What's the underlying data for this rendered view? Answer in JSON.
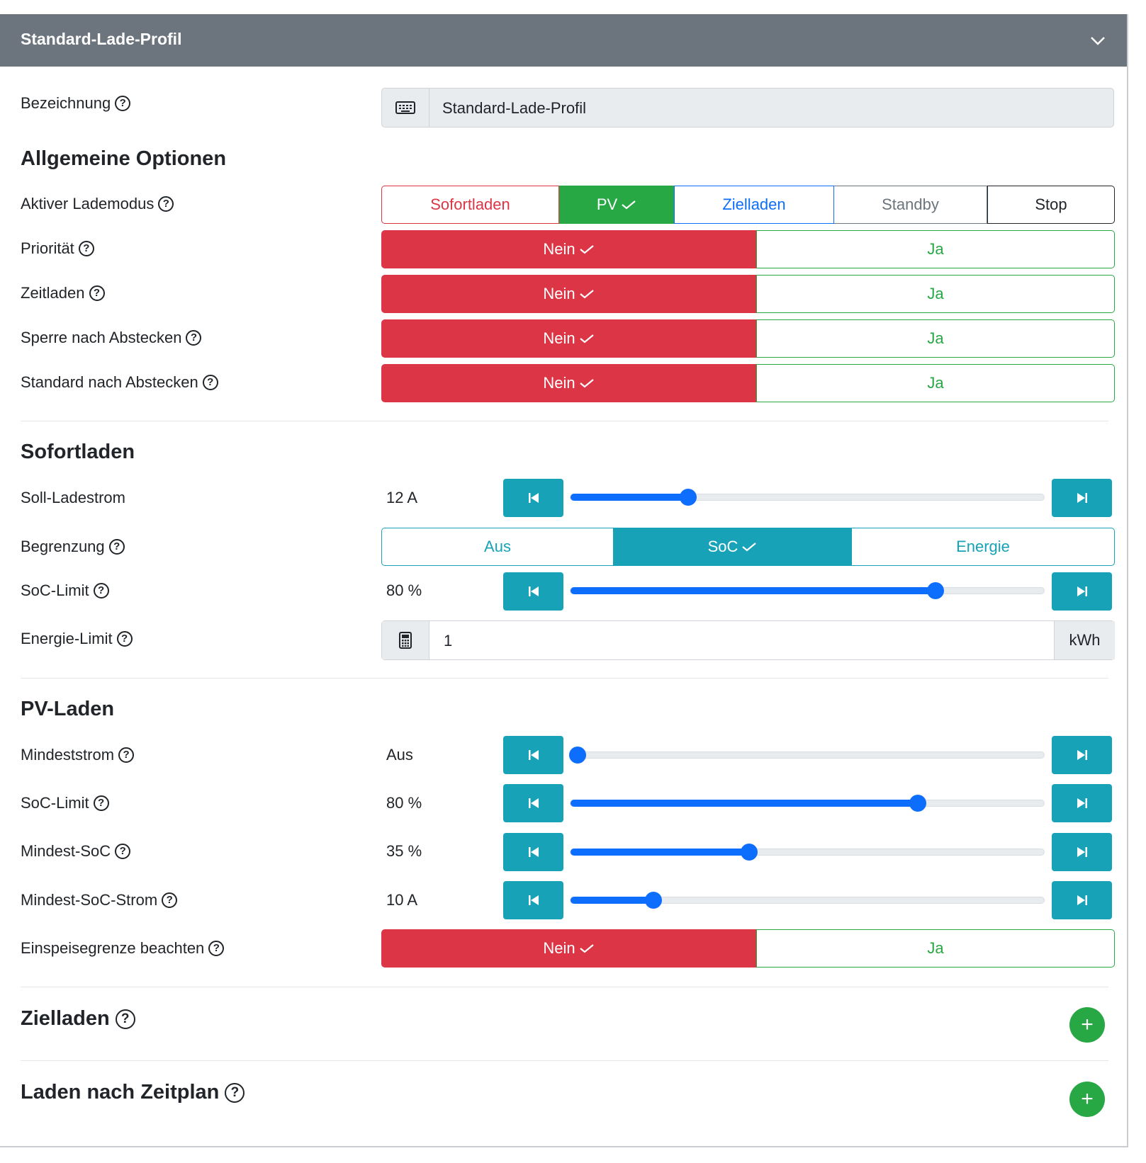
{
  "header": {
    "title": "Standard-Lade-Profil",
    "toggle_icon": "chevron-down-icon"
  },
  "colors": {
    "success": "#28a745",
    "danger": "#dc3545",
    "info": "#17a2b8",
    "primary": "#0d6efd",
    "secondary": "#6c757d"
  },
  "name_field": {
    "label": "Bezeichnung",
    "value": "Standard-Lade-Profil",
    "icon": "keyboard-icon"
  },
  "general": {
    "title": "Allgemeine Optionen",
    "mode": {
      "label": "Aktiver Lademodus",
      "options": [
        "Sofortladen",
        "PV",
        "Zielladen",
        "Standby",
        "Stop"
      ],
      "selected": "PV"
    },
    "toggles": [
      {
        "label": "Priorität",
        "no": "Nein",
        "yes": "Ja",
        "selected": "Nein"
      },
      {
        "label": "Zeitladen",
        "no": "Nein",
        "yes": "Ja",
        "selected": "Nein"
      },
      {
        "label": "Sperre nach Abstecken",
        "no": "Nein",
        "yes": "Ja",
        "selected": "Nein"
      },
      {
        "label": "Standard nach Abstecken",
        "no": "Nein",
        "yes": "Ja",
        "selected": "Nein"
      }
    ]
  },
  "instant": {
    "title": "Sofortladen",
    "current": {
      "label": "Soll-Ladestrom",
      "display": "12 A",
      "value": 12,
      "fraction": 0.24
    },
    "limit": {
      "label": "Begrenzung",
      "options": [
        "Aus",
        "SoC",
        "Energie"
      ],
      "selected": "SoC"
    },
    "soc_limit": {
      "label": "SoC-Limit",
      "display": "80 %",
      "value": 80,
      "fraction": 0.78
    },
    "energy_limit": {
      "label": "Energie-Limit",
      "value": "1",
      "unit": "kWh",
      "icon": "calculator-icon"
    }
  },
  "pv": {
    "title": "PV-Laden",
    "min_current": {
      "label": "Mindeststrom",
      "display": "Aus",
      "fraction": 0.0
    },
    "soc_limit": {
      "label": "SoC-Limit",
      "display": "80 %",
      "value": 80,
      "fraction": 0.74
    },
    "min_soc": {
      "label": "Mindest-SoC",
      "display": "35 %",
      "value": 35,
      "fraction": 0.373
    },
    "min_soc_current": {
      "label": "Mindest-SoC-Strom",
      "display": "10 A",
      "value": 10,
      "fraction": 0.165
    },
    "feed_in": {
      "label": "Einspeisegrenze beachten",
      "no": "Nein",
      "yes": "Ja",
      "selected": "Nein"
    }
  },
  "scheduled": {
    "title": "Zielladen",
    "add_icon": "plus-icon"
  },
  "timeplan": {
    "title": "Laden nach Zeitplan",
    "add_icon": "plus-icon"
  },
  "icons": {
    "help": "?",
    "plus": "+"
  }
}
